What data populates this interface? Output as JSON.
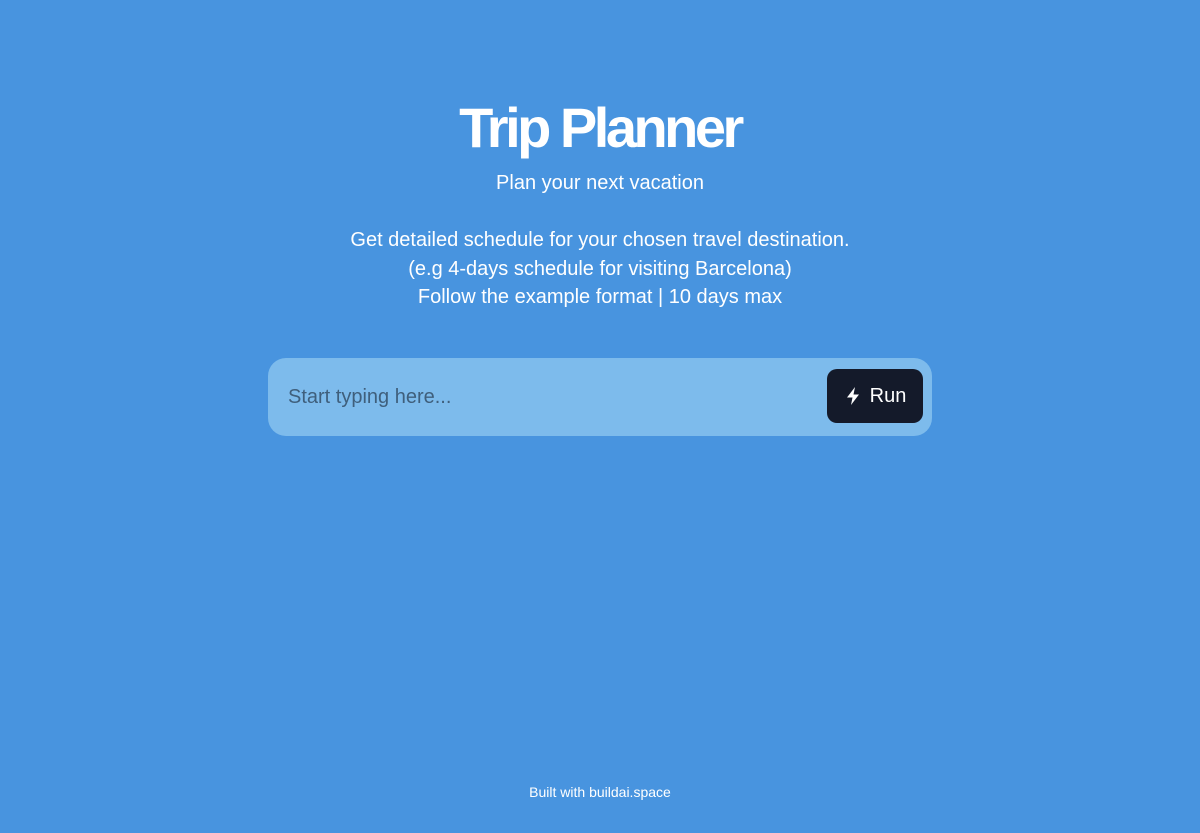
{
  "header": {
    "title": "Trip Planner",
    "subtitle": "Plan your next vacation"
  },
  "description": {
    "lines": [
      "Get detailed schedule for your chosen travel destination.",
      "(e.g 4-days schedule for visiting Barcelona)",
      "Follow the example format | 10 days max"
    ]
  },
  "prompt": {
    "value": "",
    "placeholder": "Start typing here...",
    "run_label": "Run",
    "run_icon": "lightning-bolt-icon"
  },
  "footer": {
    "text": "Built with buildai.space"
  },
  "colors": {
    "background": "#4894df",
    "input_background": "#7dbbec",
    "button_background": "#141a2a",
    "text": "#ffffff"
  }
}
